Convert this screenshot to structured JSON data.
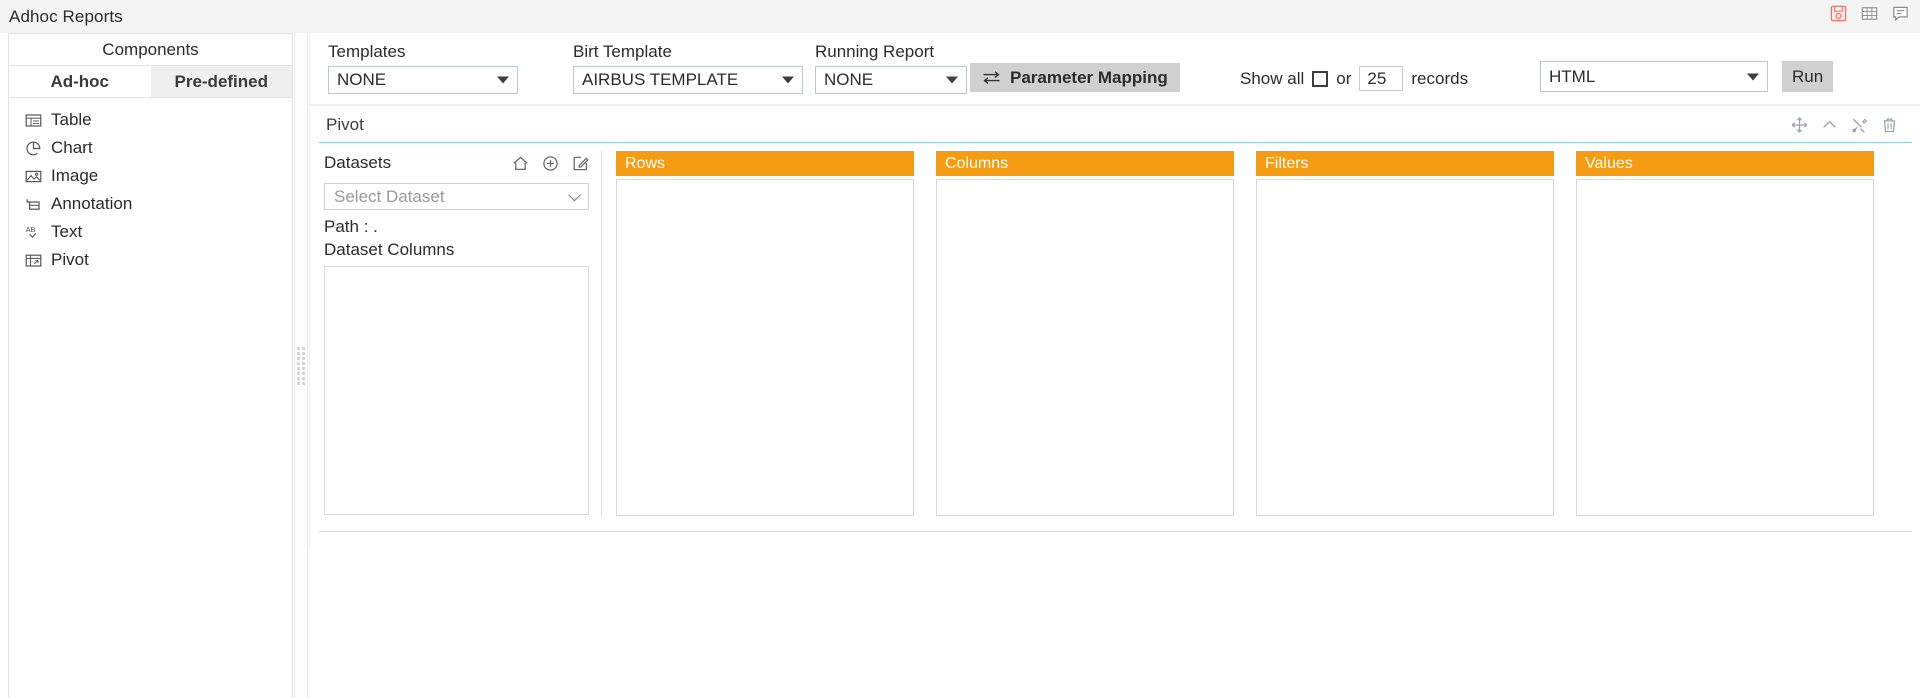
{
  "titlebar": {
    "title": "Adhoc Reports",
    "icons": [
      {
        "name": "save-icon",
        "label": "Save"
      },
      {
        "name": "grid-icon",
        "label": "Grid"
      },
      {
        "name": "comment-icon",
        "label": "Comment"
      }
    ]
  },
  "sidebar": {
    "header": "Components",
    "tabs": [
      {
        "label": "Ad-hoc",
        "active": true
      },
      {
        "label": "Pre-defined",
        "active": false
      }
    ],
    "items": [
      {
        "label": "Table",
        "icon": "table-icon"
      },
      {
        "label": "Chart",
        "icon": "chart-pie-icon"
      },
      {
        "label": "Image",
        "icon": "image-icon"
      },
      {
        "label": "Annotation",
        "icon": "annotation-icon"
      },
      {
        "label": "Text",
        "icon": "text-ab-icon"
      },
      {
        "label": "Pivot",
        "icon": "pivot-icon"
      }
    ]
  },
  "toolbar": {
    "templates_label": "Templates",
    "templates_value": "NONE",
    "birt_template_label": "Birt Template",
    "birt_template_value": "AIRBUS TEMPLATE",
    "running_report_label": "Running Report",
    "running_report_value": "NONE",
    "parameter_mapping_label": "Parameter Mapping",
    "show_all_label": "Show all",
    "or_label": "or",
    "records_value": "25",
    "records_label": "records",
    "format_value": "HTML",
    "run_label": "Run"
  },
  "pivot": {
    "title": "Pivot",
    "header_icons": [
      {
        "name": "move-icon",
        "label": "Move"
      },
      {
        "name": "chevron-up-icon",
        "label": "Collapse"
      },
      {
        "name": "tools-icon",
        "label": "Settings"
      },
      {
        "name": "trash-icon",
        "label": "Delete"
      }
    ],
    "datasets": {
      "title": "Datasets",
      "actions": [
        {
          "name": "home-icon",
          "label": "Home"
        },
        {
          "name": "plus-circle-icon",
          "label": "Add"
        },
        {
          "name": "edit-icon",
          "label": "Edit"
        }
      ],
      "select_placeholder": "Select Dataset",
      "path_label": "Path : .",
      "columns_label": "Dataset Columns"
    },
    "zones": [
      {
        "label": "Rows"
      },
      {
        "label": "Columns"
      },
      {
        "label": "Filters"
      },
      {
        "label": "Values"
      }
    ]
  },
  "colors": {
    "accent_orange": "#f59c12",
    "panel_border_teal": "#8fd3d6",
    "button_gray": "#d0d0d0",
    "save_icon_red": "#f4756b"
  }
}
